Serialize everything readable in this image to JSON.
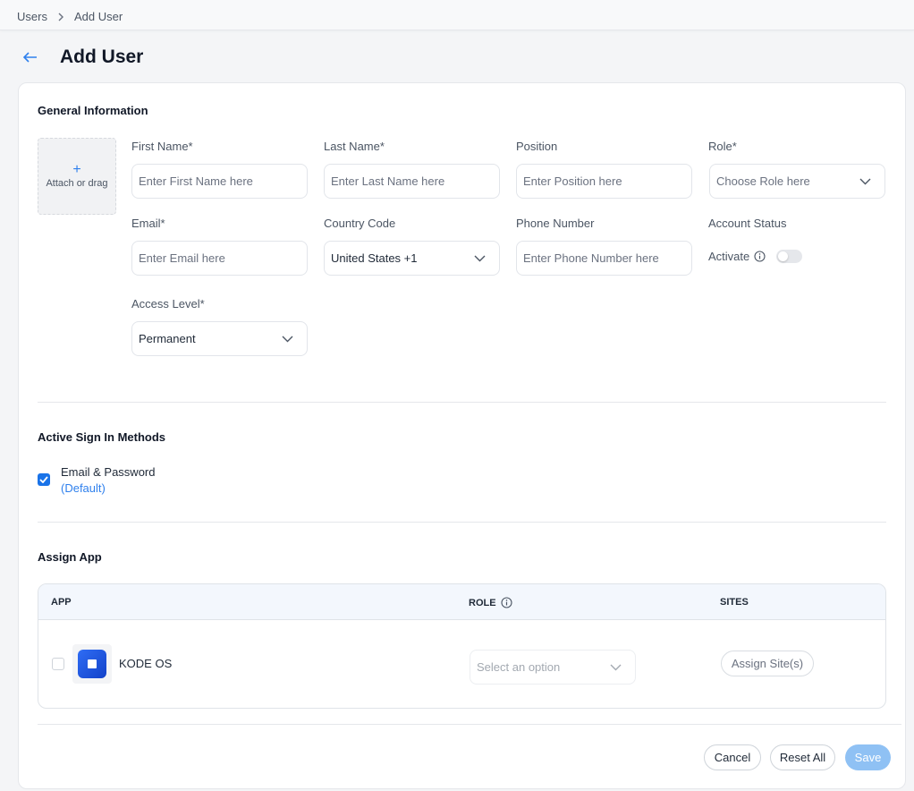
{
  "breadcrumb": {
    "root": "Users",
    "current": "Add User"
  },
  "page": {
    "title": "Add User"
  },
  "general": {
    "title": "General Information",
    "avatar_text": "Attach or drag",
    "avatar_plus": "+",
    "first_name": {
      "label": "First Name*",
      "placeholder": "Enter First Name here"
    },
    "last_name": {
      "label": "Last Name*",
      "placeholder": "Enter Last Name here"
    },
    "position": {
      "label": "Position",
      "placeholder": "Enter Position here"
    },
    "role": {
      "label": "Role*",
      "placeholder": "Choose Role here"
    },
    "email": {
      "label": "Email*",
      "placeholder": "Enter Email here"
    },
    "country_code": {
      "label": "Country Code",
      "value": "United States +1"
    },
    "phone": {
      "label": "Phone Number",
      "placeholder": "Enter Phone Number here"
    },
    "account_status": {
      "label": "Account Status",
      "toggle_label": "Activate",
      "active": false
    },
    "access_level": {
      "label": "Access Level*",
      "value": "Permanent"
    }
  },
  "sign_in": {
    "title": "Active Sign In Methods",
    "method_label": "Email & Password",
    "method_default": "(Default)",
    "checked": true
  },
  "assign_app": {
    "title": "Assign App",
    "columns": {
      "app": "APP",
      "role": "ROLE",
      "sites": "SITES"
    },
    "rows": [
      {
        "name": "KODE OS",
        "role_placeholder": "Select an option",
        "sites_button": "Assign Site(s)"
      }
    ]
  },
  "actions": {
    "cancel": "Cancel",
    "reset": "Reset All",
    "save": "Save"
  },
  "colors": {
    "accent": "#1a73e8",
    "save_disabled": "#8fc1f4",
    "header_bg": "#f3f7fd"
  }
}
